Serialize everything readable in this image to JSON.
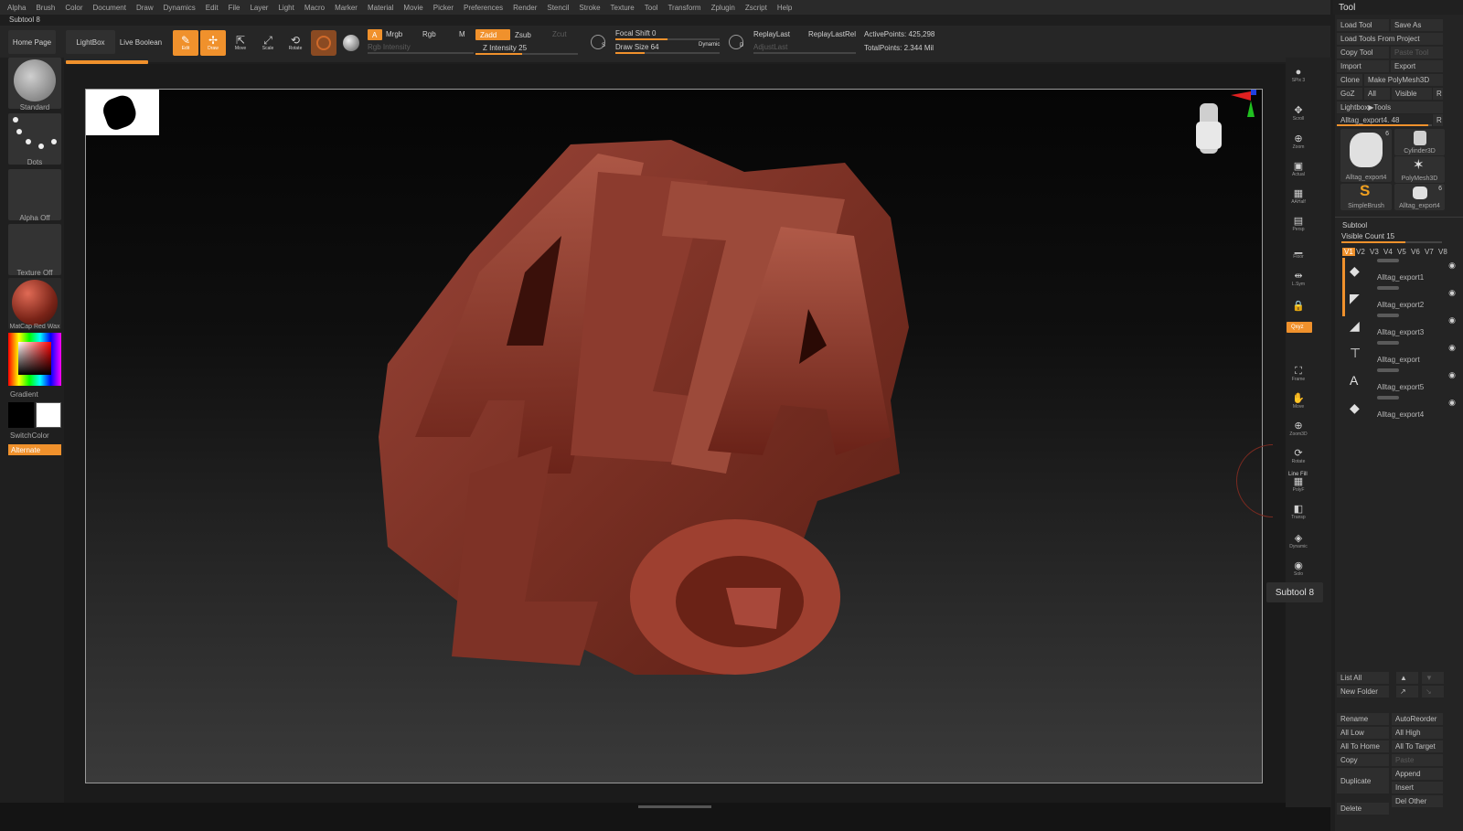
{
  "menu": [
    "Alpha",
    "Brush",
    "Color",
    "Document",
    "Draw",
    "Dynamics",
    "Edit",
    "File",
    "Layer",
    "Light",
    "Macro",
    "Marker",
    "Material",
    "Movie",
    "Picker",
    "Preferences",
    "Render",
    "Stencil",
    "Stroke",
    "Texture",
    "Tool",
    "Transform",
    "Zplugin",
    "Zscript",
    "Help"
  ],
  "subtool_title": "Subtool 8",
  "shelf": {
    "home": "Home Page",
    "lightbox": "LightBox",
    "live_boolean": "Live Boolean",
    "modes": [
      "Edit",
      "Draw",
      "Move",
      "Scale",
      "Rotate"
    ],
    "a_label": "A",
    "mrgb": "Mrgb",
    "rgb": "Rgb",
    "m": "M",
    "zadd": "Zadd",
    "zsub": "Zsub",
    "zcut": "Zcut",
    "rgb_intensity": "Rgb Intensity",
    "z_intensity": "Z Intensity 25",
    "s_label": "S",
    "focal_shift": "Focal Shift 0",
    "draw_size": "Draw Size 64",
    "dynamic": "Dynamic",
    "d_label": "D",
    "replay_last": "ReplayLast",
    "replay_last_rel": "ReplayLastRel",
    "adjust_last": "AdjustLast",
    "active_points": "ActivePoints: 425,298",
    "total_points": "TotalPoints: 2.344 Mil"
  },
  "left": {
    "brush": "Standard",
    "stroke": "Dots",
    "alpha": "Alpha Off",
    "texture": "Texture Off",
    "material": "MatCap Red Wax",
    "gradient": "Gradient",
    "switch_color": "SwitchColor",
    "alternate": "Alternate"
  },
  "viewport": {
    "model_text": "ALTAG"
  },
  "rstrip": [
    {
      "name": "SPix 3",
      "g": "●"
    },
    {
      "name": "Scroll",
      "g": "✥"
    },
    {
      "name": "Zoom",
      "g": "⊕"
    },
    {
      "name": "Actual",
      "g": "▣"
    },
    {
      "name": "AAHalf",
      "g": "▦"
    },
    {
      "name": "Persp",
      "g": "▤"
    },
    {
      "name": "Floor",
      "g": "▁"
    },
    {
      "name": "L.Sym",
      "g": "⇹"
    },
    {
      "name": "",
      "g": "🔒"
    },
    {
      "name": "Frame",
      "g": "⛶"
    },
    {
      "name": "Move",
      "g": "✋"
    },
    {
      "name": "Zoom3D",
      "g": "⊕"
    },
    {
      "name": "Rotate",
      "g": "⟳"
    },
    {
      "name": "PolyF",
      "g": "▦"
    },
    {
      "name": "Transp",
      "g": "◧"
    },
    {
      "name": "Dynamic",
      "g": "◈"
    },
    {
      "name": "Solo",
      "g": "◉"
    }
  ],
  "rstrip_xyz": "Qxyz",
  "rstrip_linefill": "Line Fill",
  "tooltip": "Subtool 8",
  "palette": {
    "title": "Tool",
    "load_tool": "Load Tool",
    "save_as": "Save As",
    "load_from_project": "Load Tools From Project",
    "copy_tool": "Copy Tool",
    "paste_tool": "Paste Tool",
    "import": "Import",
    "export": "Export",
    "clone": "Clone",
    "make_polymesh": "Make PolyMesh3D",
    "goz": "GoZ",
    "all": "All",
    "visible": "Visible",
    "r": "R",
    "lightbox_tools": "Lightbox▶Tools",
    "current_tool": "Alltag_export4. 48",
    "tools": [
      {
        "name": "Alltag_export4",
        "count": "6"
      },
      {
        "name": "Cylinder3D",
        "count": ""
      },
      {
        "name": "PolyMesh3D",
        "count": ""
      },
      {
        "name": "SimpleBrush",
        "count": ""
      },
      {
        "name": "Alltag_export4",
        "count": "6"
      }
    ],
    "subtool_header": "Subtool",
    "visible_count": "Visible Count 15",
    "vtabs": [
      "V1",
      "V2",
      "V3",
      "V4",
      "V5",
      "V6",
      "V7",
      "V8"
    ],
    "subtools": [
      "Alltag_export1",
      "Alltag_export2",
      "Alltag_export3",
      "Alltag_export",
      "Alltag_export5",
      "Alltag_export4"
    ],
    "list_all": "List All",
    "new_folder": "New Folder",
    "rename": "Rename",
    "auto_reorder": "AutoReorder",
    "all_low": "All Low",
    "all_high": "All High",
    "all_to_home": "All To Home",
    "all_to_target": "All To Target",
    "copy": "Copy",
    "paste": "Paste",
    "duplicate": "Duplicate",
    "append": "Append",
    "insert": "Insert",
    "del_other": "Del Other",
    "delete": "Delete"
  },
  "colors": {
    "accent": "#f0912c",
    "model": "#8a3a2e"
  }
}
